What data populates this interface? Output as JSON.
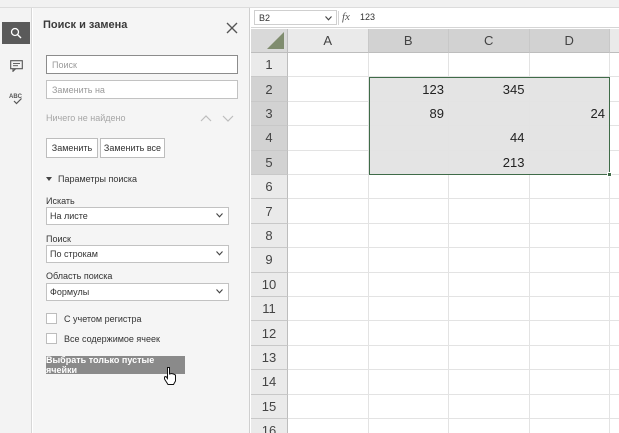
{
  "rail": {
    "items": [
      {
        "icon": "search-icon"
      },
      {
        "icon": "comment-icon"
      },
      {
        "icon": "spellcheck-icon",
        "label": "ABC"
      }
    ]
  },
  "panel": {
    "title": "Поиск и замена",
    "find_placeholder": "Поиск",
    "replace_placeholder": "Заменить на",
    "status": "Ничего не найдено",
    "replace_label": "Заменить",
    "replace_all_label": "Заменить все",
    "params_label": "Параметры поиска",
    "within_label": "Искать",
    "within_value": "На листе",
    "search_label": "Поиск",
    "search_value": "По строкам",
    "lookin_label": "Область поиска",
    "lookin_value": "Формулы",
    "match_case_label": "С учетом регистра",
    "entire_cell_label": "Все содержимое ячеек",
    "select_empty_label": "Выбрать только пустые ячейки"
  },
  "formula_bar": {
    "name_box": "B2",
    "fx": "fx",
    "value": "123"
  },
  "sheet": {
    "columns": [
      "A",
      "B",
      "C",
      "D"
    ],
    "rows": [
      "1",
      "2",
      "3",
      "4",
      "5",
      "6",
      "7",
      "8",
      "9",
      "10",
      "11",
      "12",
      "13",
      "14",
      "15",
      "16"
    ],
    "cells": {
      "B2": "123",
      "C2": "345",
      "B3": "89",
      "D3": "24",
      "C4": "44",
      "C5": "213"
    },
    "selection": "B2:D5"
  },
  "colors": {
    "selection_border": "#3f6b48",
    "selection_fill": "#e4e4e4",
    "rail_active": "#5a5a5a"
  }
}
